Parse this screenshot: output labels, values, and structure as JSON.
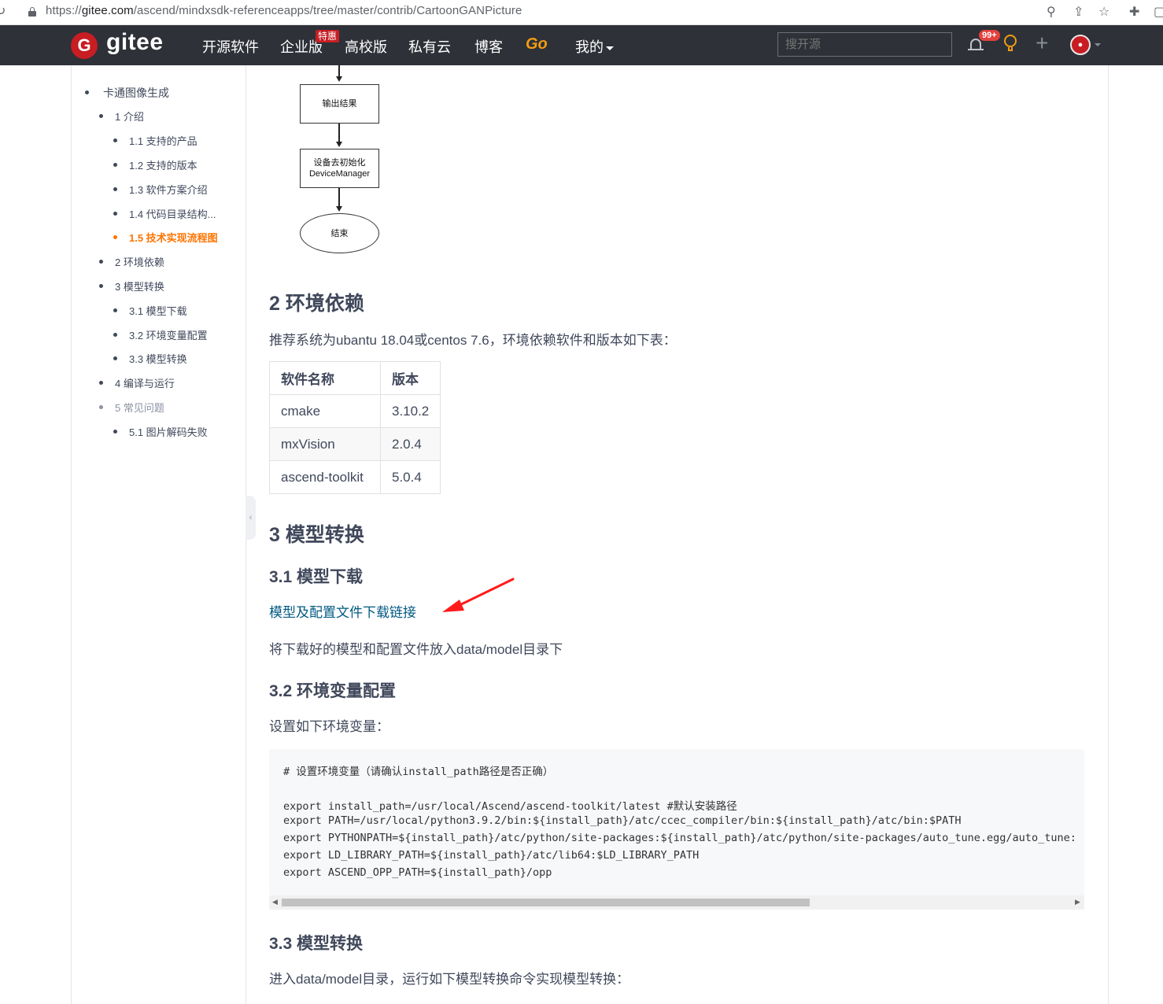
{
  "browser": {
    "url_prefix": "https://",
    "url_host": "gitee.com",
    "url_path": "/ascend/mindxsdk-referenceapps/tree/master/contrib/CartoonGANPicture",
    "icons": [
      "reload-icon",
      "lock-icon",
      "zoom-icon",
      "share-icon",
      "star-icon",
      "extensions-icon",
      "window-icon"
    ]
  },
  "nav": {
    "logo_mark": "G",
    "logo_text": "gitee",
    "items": [
      "开源软件",
      "企业版",
      "高校版",
      "私有云",
      "博客"
    ],
    "special_badge": "特惠",
    "go": "Go",
    "mine": "我的",
    "search_placeholder": "搜开源",
    "notification_count": "99+",
    "brand_color": "#c71d23",
    "nav_bg": "#2e3138"
  },
  "toc": [
    {
      "label": "卡通图像生成",
      "level": 1,
      "state": "normal"
    },
    {
      "label": "1 介绍",
      "level": 2,
      "state": "normal"
    },
    {
      "label": "1.1 支持的产品",
      "level": 3,
      "state": "normal"
    },
    {
      "label": "1.2 支持的版本",
      "level": 3,
      "state": "normal"
    },
    {
      "label": "1.3 软件方案介绍",
      "level": 3,
      "state": "normal"
    },
    {
      "label": "1.4 代码目录结构...",
      "level": 3,
      "state": "normal"
    },
    {
      "label": "1.5 技术实现流程图",
      "level": 3,
      "state": "active"
    },
    {
      "label": "2 环境依赖",
      "level": 2,
      "state": "normal"
    },
    {
      "label": "3 模型转换",
      "level": 2,
      "state": "normal"
    },
    {
      "label": "3.1 模型下载",
      "level": 3,
      "state": "normal"
    },
    {
      "label": "3.2 环境变量配置",
      "level": 3,
      "state": "normal"
    },
    {
      "label": "3.3 模型转换",
      "level": 3,
      "state": "normal"
    },
    {
      "label": "4 编译与运行",
      "level": 2,
      "state": "normal"
    },
    {
      "label": "5 常见问题",
      "level": 2,
      "state": "muted"
    },
    {
      "label": "5.1 图片解码失败",
      "level": 3,
      "state": "normal"
    }
  ],
  "flowchart": {
    "output_box": "输出结果",
    "deinit_box_line1": "设备去初始化",
    "deinit_box_line2": "DeviceManager",
    "end_oval": "结束"
  },
  "content": {
    "h_env": "2 环境依赖",
    "env_desc": "推荐系统为ubantu 18.04或centos 7.6，环境依赖软件和版本如下表：",
    "table": {
      "headers": [
        "软件名称",
        "版本"
      ],
      "rows": [
        [
          "cmake",
          "3.10.2"
        ],
        [
          "mxVision",
          "2.0.4"
        ],
        [
          "ascend-toolkit",
          "5.0.4"
        ]
      ]
    },
    "h_model": "3 模型转换",
    "h_download": "3.1 模型下载",
    "download_link": "模型及配置文件下载链接",
    "download_desc": "将下载好的模型和配置文件放入data/model目录下",
    "h_envvar": "3.2 环境变量配置",
    "envvar_desc": "设置如下环境变量：",
    "code": [
      "# 设置环境变量（请确认install_path路径是否正确）",
      "",
      "export install_path=/usr/local/Ascend/ascend-toolkit/latest #默认安装路径",
      "export PATH=/usr/local/python3.9.2/bin:${install_path}/atc/ccec_compiler/bin:${install_path}/atc/bin:$PATH",
      "export PYTHONPATH=${install_path}/atc/python/site-packages:${install_path}/atc/python/site-packages/auto_tune.egg/auto_tune:",
      "export LD_LIBRARY_PATH=${install_path}/atc/lib64:$LD_LIBRARY_PATH",
      "export ASCEND_OPP_PATH=${install_path}/opp"
    ],
    "h_convert": "3.3 模型转换",
    "convert_desc": "进入data/model目录，运行如下模型转换命令实现模型转换："
  }
}
